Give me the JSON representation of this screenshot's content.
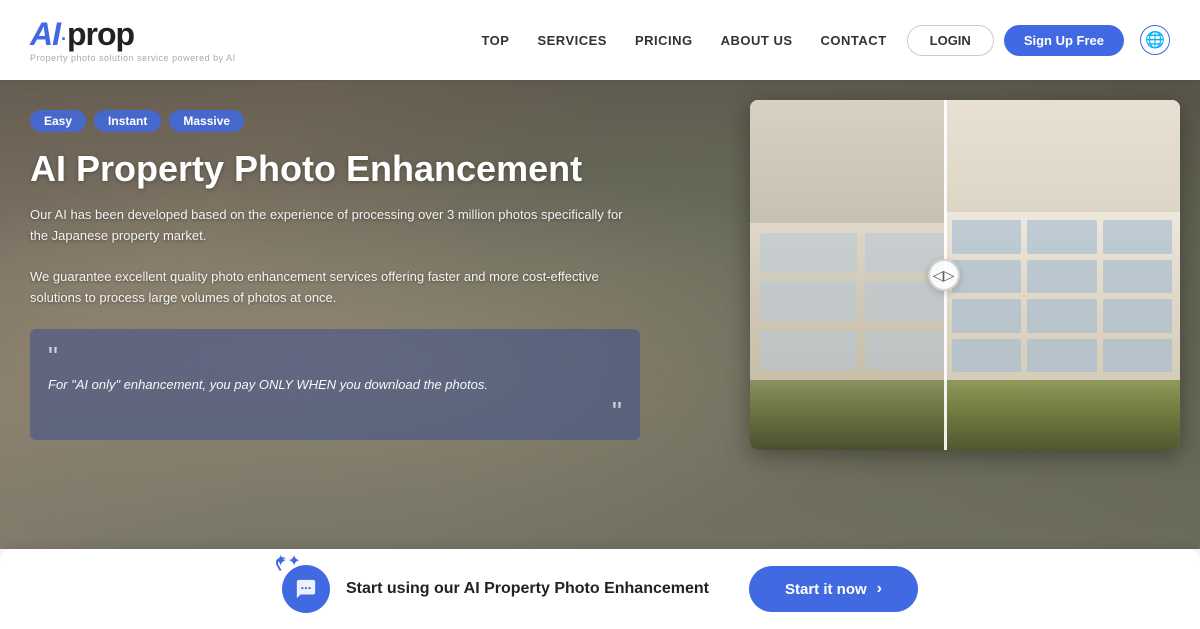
{
  "navbar": {
    "logo_ai": "AI",
    "logo_dot": "·",
    "logo_prop": "prop",
    "logo_subtitle": "Property photo solution service powered by AI",
    "nav_items": [
      {
        "label": "TOP",
        "id": "nav-top"
      },
      {
        "label": "SERVICES",
        "id": "nav-services"
      },
      {
        "label": "PRICING",
        "id": "nav-pricing"
      },
      {
        "label": "ABOUT US",
        "id": "nav-about"
      },
      {
        "label": "CONTACT",
        "id": "nav-contact"
      }
    ],
    "login_label": "LOGIN",
    "signup_label": "Sign Up Free",
    "globe_icon": "🌐"
  },
  "hero": {
    "badges": [
      "Easy",
      "Instant",
      "Massive"
    ],
    "title": "AI Property Photo Enhancement",
    "description_1": "Our AI has been developed based on the experience of processing over 3 million photos specifically for the Japanese property market.",
    "description_2": "We guarantee excellent quality photo enhancement services offering faster and more cost-effective solutions to process large volumes of photos at once.",
    "quote": "For \"AI only\" enhancement, you pay ONLY WHEN you download the photos."
  },
  "cta": {
    "text": "Start using our AI Property Photo Enhancement",
    "button_label": "Start it now",
    "arrow": "›"
  }
}
